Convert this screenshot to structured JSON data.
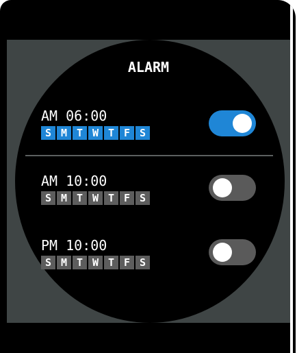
{
  "title": "ALARM",
  "alarms": [
    {
      "time": "AM 06:00",
      "enabled": true,
      "days": [
        "S",
        "M",
        "T",
        "W",
        "T",
        "F",
        "S"
      ]
    },
    {
      "time": "AM 10:00",
      "enabled": false,
      "days": [
        "S",
        "M",
        "T",
        "W",
        "T",
        "F",
        "S"
      ]
    },
    {
      "time": "PM 10:00",
      "enabled": false,
      "days": [
        "S",
        "M",
        "T",
        "W",
        "T",
        "F",
        "S"
      ]
    }
  ],
  "colors": {
    "accent": "#1f86d6",
    "toggle_off": "#5a5a5a",
    "day_inactive": "#5d5d5d",
    "background": "#000000",
    "surround": "#3f4545"
  }
}
